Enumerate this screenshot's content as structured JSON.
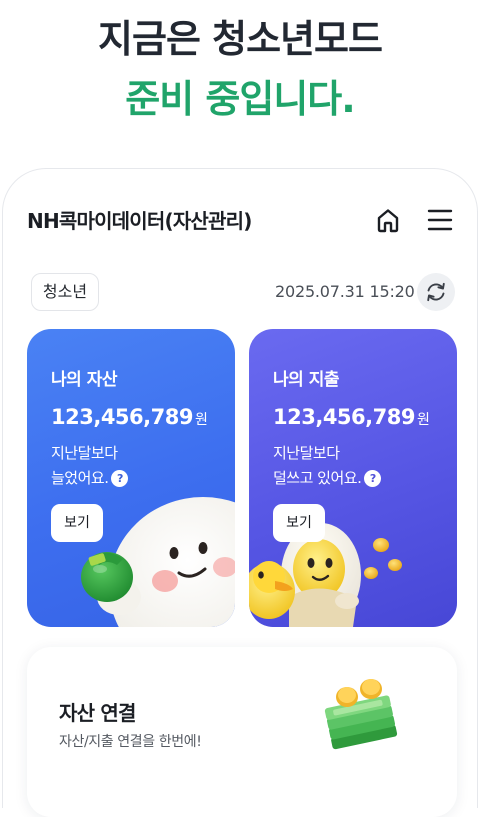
{
  "hero": {
    "line1": "지금은 청소년모드",
    "line2": "준비 중입니다."
  },
  "header": {
    "app_title": "NH콕마이데이터(자산관리)",
    "home_icon": "home-icon",
    "menu_icon": "menu-icon"
  },
  "status": {
    "mode_badge": "청소년",
    "timestamp": "2025.07.31 15:20",
    "refresh_icon": "refresh-icon"
  },
  "cards": {
    "assets": {
      "title": "나의 자산",
      "amount": "123,456,789",
      "unit": "원",
      "desc_line1": "지난달보다",
      "desc_line2": "늘었어요.",
      "help": "?",
      "button": "보기",
      "color": "#4a82f4"
    },
    "spending": {
      "title": "나의 지출",
      "amount": "123,456,789",
      "unit": "원",
      "desc_line1": "지난달보다",
      "desc_line2": "덜쓰고 있어요.",
      "help": "?",
      "button": "보기",
      "color": "#6262ea"
    }
  },
  "connect": {
    "title": "자산 연결",
    "subtitle": "자산/지출 연결을 한번에!",
    "icon": "money-stack-icon"
  },
  "colors": {
    "brand_green": "#20a46a",
    "heading_dark": "#222832"
  }
}
